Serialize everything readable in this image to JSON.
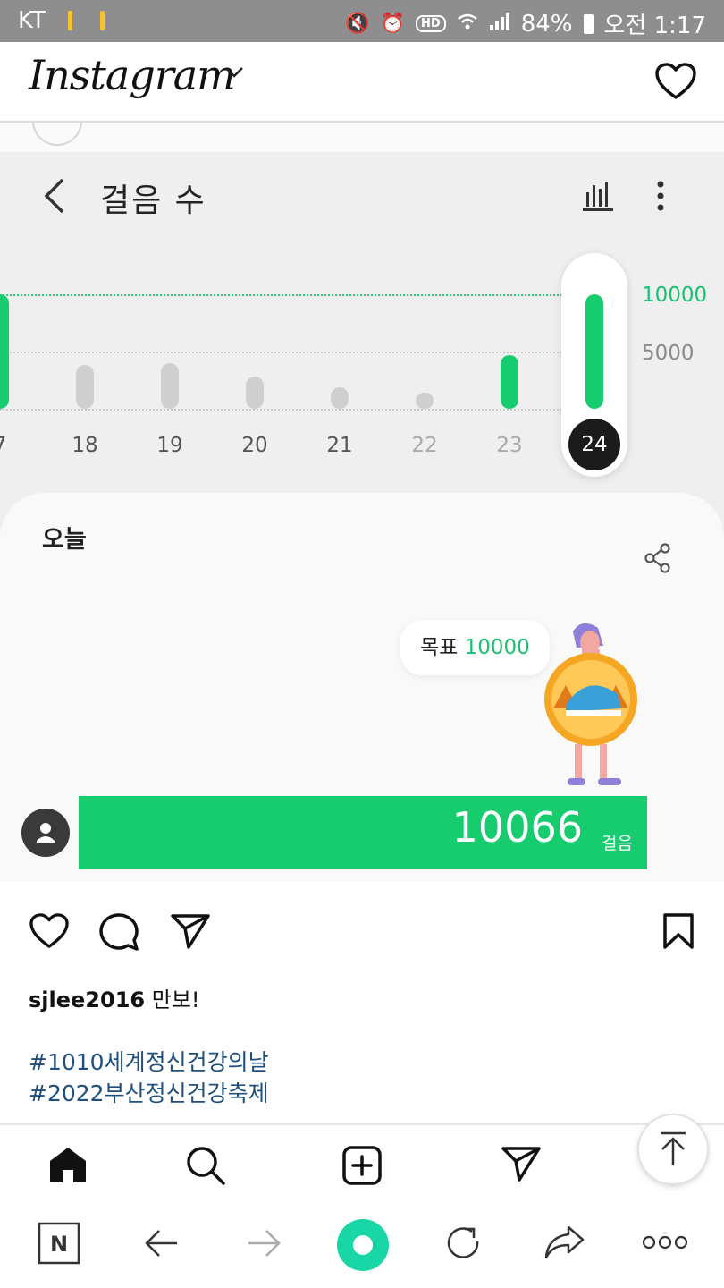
{
  "status_bar": {
    "carrier": "KT",
    "battery": "84%",
    "time": "오전 1:17",
    "hd_label": "HD",
    "icons": [
      "mute-icon",
      "alarm-icon",
      "hd-icon",
      "wifi-icon",
      "signal-icon",
      "battery-icon"
    ]
  },
  "instagram": {
    "logo_text": "Instagram",
    "icons": [
      "chevron-down-icon",
      "heart-icon"
    ]
  },
  "steps_app": {
    "title": "걸음 수",
    "y_axis": {
      "goal_label": "10000",
      "mid_label": "5000"
    },
    "selected_day": "24",
    "today_label": "오늘",
    "goal_prefix": "목표",
    "goal_value": "10000",
    "steps_value": "10066",
    "steps_unit": "걸음",
    "progress_fraction": 1.0
  },
  "chart_data": {
    "type": "bar",
    "categories": [
      "7",
      "18",
      "19",
      "20",
      "21",
      "22",
      "23",
      "24"
    ],
    "values": [
      10000,
      3800,
      4000,
      2800,
      1900,
      1000,
      4700,
      10066
    ],
    "goal": 10000,
    "ylim": [
      0,
      10000
    ],
    "y_ticks": [
      "5000",
      "10000"
    ],
    "highlight": "24",
    "goal_met_color": "#17cc6e",
    "below_goal_color": "#cfcfcf"
  },
  "post": {
    "username": "sjlee2016",
    "caption": "만보!",
    "hashtags": [
      "#1010세계정신건강의날",
      "#2022부산정신건강축제"
    ],
    "action_icons": [
      "heart-icon",
      "comment-icon",
      "send-icon",
      "bookmark-icon"
    ]
  },
  "ig_nav": {
    "items": [
      "home-icon",
      "search-icon",
      "create-icon",
      "direct-icon"
    ]
  },
  "browser_bar": {
    "n_label": "N",
    "items": [
      "naver-icon",
      "back-arrow-icon",
      "forward-arrow-icon",
      "green-dot-icon",
      "refresh-icon",
      "share-icon",
      "more-icon"
    ]
  }
}
